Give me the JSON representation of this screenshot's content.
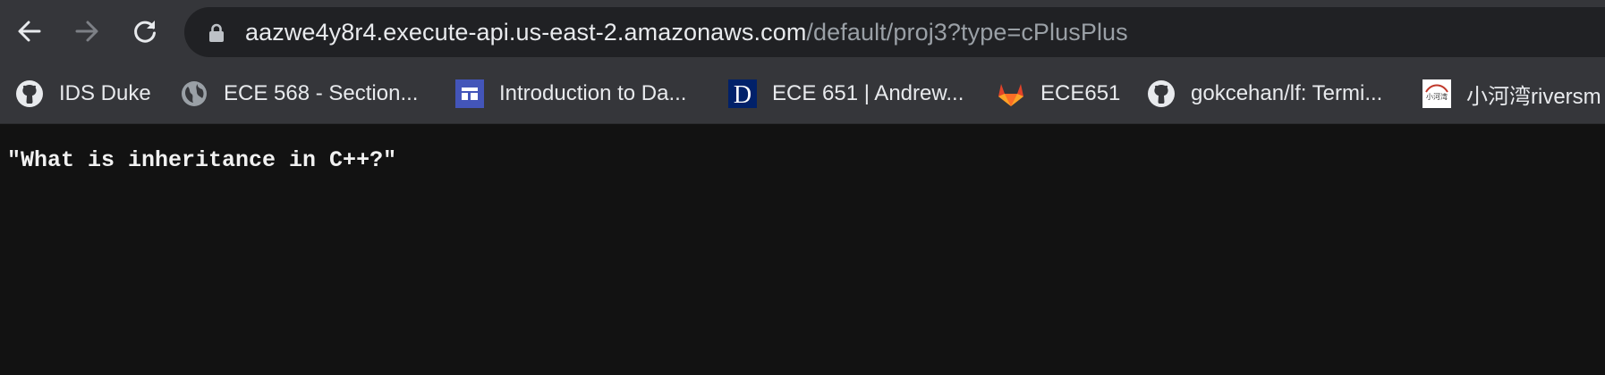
{
  "toolbar": {
    "back_icon": "arrow-left-icon",
    "forward_icon": "arrow-right-icon",
    "reload_icon": "reload-icon"
  },
  "address_bar": {
    "host": "aazwe4y8r4.execute-api.us-east-2.amazonaws.com",
    "path": "/default/proj3?type=cPlusPlus",
    "lock_icon": "lock-icon"
  },
  "bookmarks": [
    {
      "label": "IDS Duke",
      "icon": "github-icon"
    },
    {
      "label": "ECE 568 - Section...",
      "icon": "globe-icon"
    },
    {
      "label": "Introduction to Da...",
      "icon": "layout-icon"
    },
    {
      "label": "ECE 651 | Andrew...",
      "icon": "duke-d-icon",
      "icon_text": "D"
    },
    {
      "label": "ECE651",
      "icon": "gitlab-icon"
    },
    {
      "label": "gokcehan/lf: Termi...",
      "icon": "github-icon"
    },
    {
      "label": "小河湾riversm",
      "icon": "riverbay-logo-icon",
      "icon_text": "小河湾"
    }
  ],
  "page": {
    "response_text": "\"What is inheritance in C++?\""
  },
  "colors": {
    "toolbar_bg": "#35363a",
    "omnibox_bg": "#202124",
    "page_bg": "#121212",
    "host_text": "#e8eaed",
    "path_text": "#9aa0a6"
  }
}
